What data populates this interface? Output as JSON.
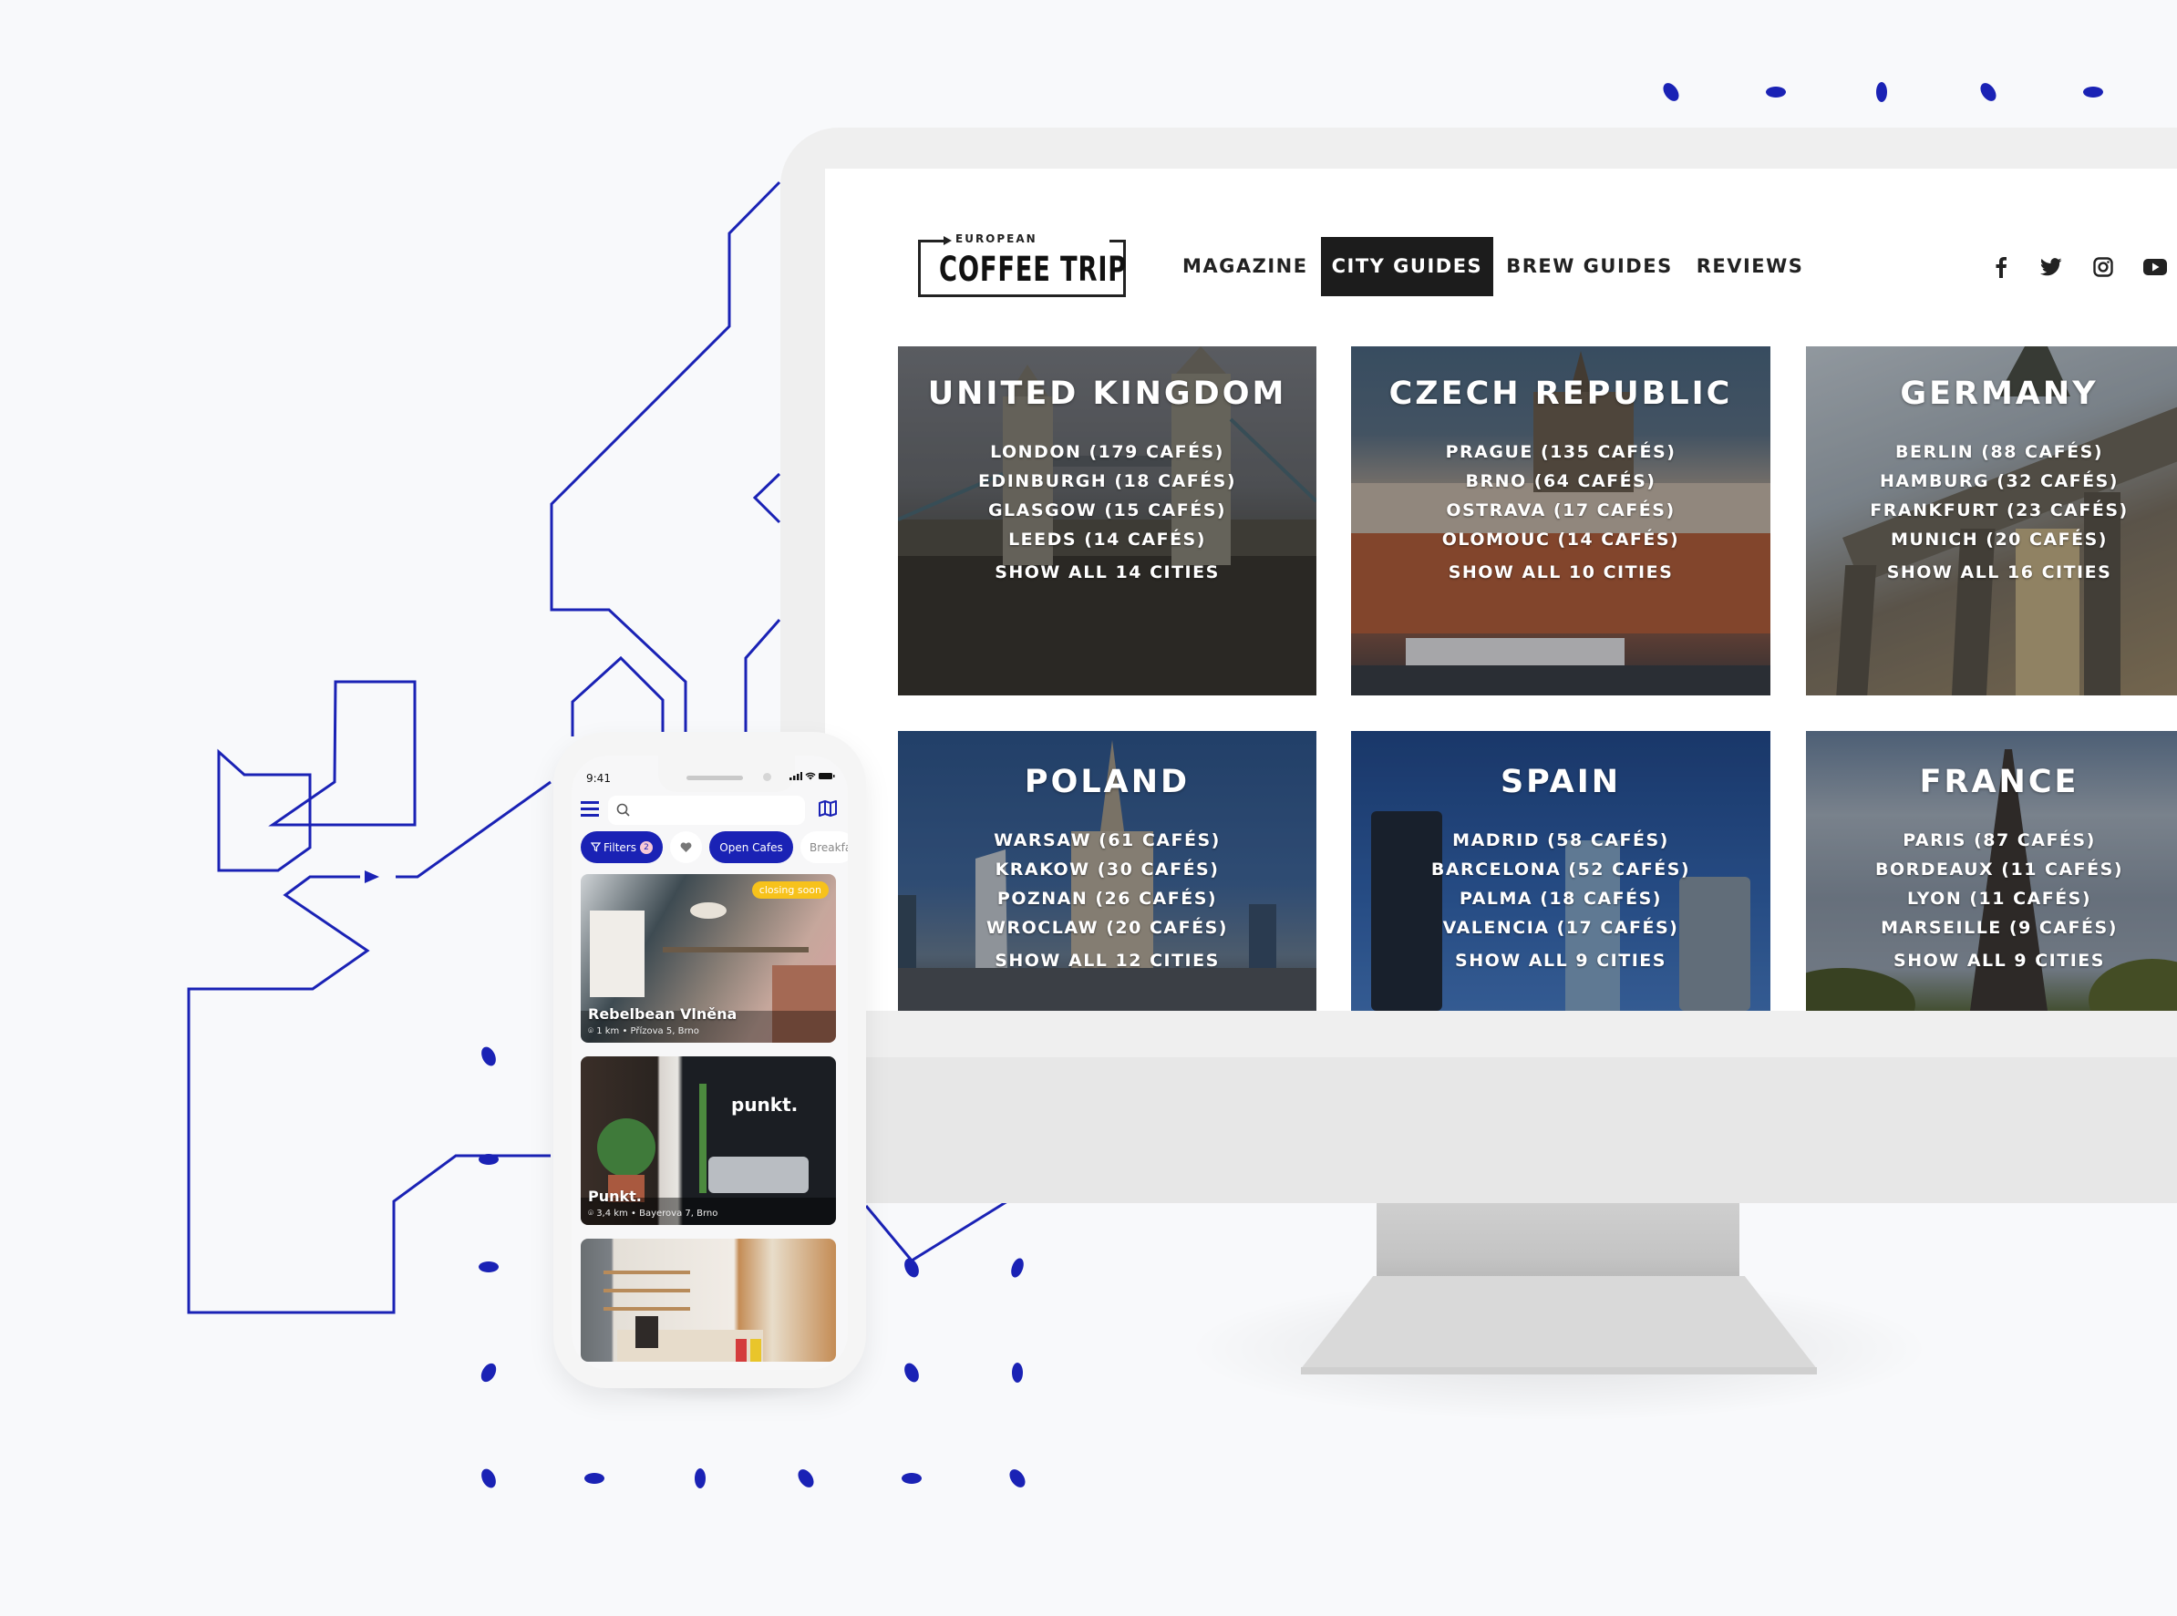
{
  "colors": {
    "accent_blue": "#1a22b5",
    "nav_active_bg": "#1c1c1c",
    "closing_soon": "#f7c21b"
  },
  "website": {
    "logo": {
      "top": "EUROPEAN",
      "main": "COFFEE TRIP"
    },
    "nav": [
      {
        "label": "MAGAZINE",
        "active": false
      },
      {
        "label": "CITY GUIDES",
        "active": true
      },
      {
        "label": "BREW GUIDES",
        "active": false
      },
      {
        "label": "REVIEWS",
        "active": false
      }
    ],
    "social": [
      "facebook-icon",
      "twitter-icon",
      "instagram-icon",
      "youtube-icon"
    ],
    "countries": [
      {
        "name": "UNITED KINGDOM",
        "cities": [
          "LONDON (179 CAFÉS)",
          "EDINBURGH (18 CAFÉS)",
          "GLASGOW (15 CAFÉS)",
          "LEEDS (14 CAFÉS)"
        ],
        "show_all": "SHOW ALL 14 CITIES"
      },
      {
        "name": "CZECH REPUBLIC",
        "cities": [
          "PRAGUE (135 CAFÉS)",
          "BRNO (64 CAFÉS)",
          "OSTRAVA (17 CAFÉS)",
          "OLOMOUC (14 CAFÉS)"
        ],
        "show_all": "SHOW ALL 10 CITIES"
      },
      {
        "name": "GERMANY",
        "cities": [
          "BERLIN (88 CAFÉS)",
          "HAMBURG (32 CAFÉS)",
          "FRANKFURT (23 CAFÉS)",
          "MUNICH (20 CAFÉS)"
        ],
        "show_all": "SHOW ALL 16 CITIES"
      },
      {
        "name": "POLAND",
        "cities": [
          "WARSAW (61 CAFÉS)",
          "KRAKOW (30 CAFÉS)",
          "POZNAN (26 CAFÉS)",
          "WROCLAW (20 CAFÉS)"
        ],
        "show_all": "SHOW ALL 12 CITIES"
      },
      {
        "name": "SPAIN",
        "cities": [
          "MADRID (58 CAFÉS)",
          "BARCELONA (52 CAFÉS)",
          "PALMA (18 CAFÉS)",
          "VALENCIA (17 CAFÉS)"
        ],
        "show_all": "SHOW ALL 9 CITIES"
      },
      {
        "name": "FRANCE",
        "cities": [
          "PARIS (87 CAFÉS)",
          "BORDEAUX (11 CAFÉS)",
          "LYON (11 CAFÉS)",
          "MARSEILLE (9 CAFÉS)"
        ],
        "show_all": "SHOW ALL 9 CITIES"
      }
    ]
  },
  "mobile_app": {
    "status_time": "9:41",
    "search_placeholder": "",
    "chips": {
      "filters": "Filters",
      "filters_count": "2",
      "open_cafes": "Open Cafes",
      "breakfast": "Breakfast"
    },
    "cafes": [
      {
        "name": "Rebelbean Vlněna",
        "distance": "1 km",
        "address": "Přízova 5, Brno",
        "badge": "closing soon"
      },
      {
        "name": "Punkt.",
        "distance": "3,4 km",
        "address": "Bayerova 7, Brno",
        "badge": ""
      },
      {
        "name": "",
        "distance": "",
        "address": "",
        "badge": ""
      }
    ]
  }
}
